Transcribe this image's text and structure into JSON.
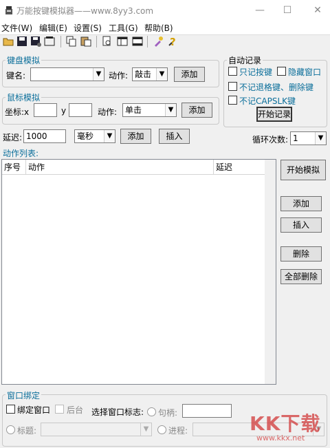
{
  "window": {
    "title": "万能按键模拟器——www.8yy3.com"
  },
  "menu": [
    "文件(W)",
    "编辑(E)",
    "设置(S)",
    "工具(G)",
    "帮助(B)"
  ],
  "toolbar": {
    "icons": [
      "open-folder-icon",
      "save-icon",
      "save-as-icon",
      "settings-icon",
      "copy-icon",
      "paste-icon",
      "preview-icon",
      "columns-icon",
      "window-icon",
      "tools-icon",
      "help-icon"
    ]
  },
  "keyboard": {
    "group_label": "键盘模拟",
    "key_label": "键名:",
    "key_value": "",
    "action_label": "动作:",
    "action_value": "敲击",
    "add_label": "添加"
  },
  "mouse": {
    "group_label": "鼠标模拟",
    "coord_label": "坐标:x",
    "x_value": "",
    "y_label": "y",
    "y_value": "",
    "action_label": "动作:",
    "action_value": "单击",
    "add_label": "添加"
  },
  "autorecord": {
    "group_label": "自动记录",
    "only_keys": "只记按键",
    "hide_window": "隐藏窗口",
    "skip_backspace": "不记退格键、删除键",
    "skip_capslk": "不记CAPSLK键",
    "start_label": "开始记录"
  },
  "delay": {
    "label": "延迟:",
    "value": "1000",
    "unit": "毫秒",
    "add_label": "添加",
    "insert_label": "插入"
  },
  "loop": {
    "label": "循环次数:",
    "value": "1"
  },
  "action_list": {
    "title": "动作列表:",
    "columns": [
      "序号",
      "动作",
      "延迟"
    ]
  },
  "side_buttons": {
    "start_sim": "开始模拟",
    "add": "添加",
    "insert": "插入",
    "delete": "删除",
    "delete_all": "全部删除"
  },
  "window_bind": {
    "group_label": "窗口绑定",
    "bind_window": "绑定窗口",
    "background": "后台",
    "select_flag": "选择窗口标志:",
    "handle_label": "句柄:",
    "title_label": "标题:",
    "process_label": "进程:"
  },
  "watermark": {
    "text": "KK下载",
    "url": "www.kkx.net"
  },
  "colors": {
    "accent_text": "#0a6e9a",
    "watermark": "#d23a3a"
  }
}
